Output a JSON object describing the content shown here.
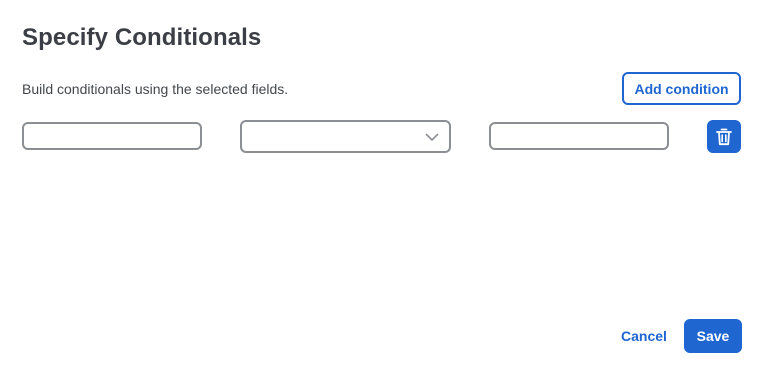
{
  "dialog": {
    "title": "Specify Conditionals",
    "description": "Build conditionals using the selected fields.",
    "add_condition_label": "Add condition",
    "cancel_label": "Cancel",
    "save_label": "Save"
  },
  "condition_row": {
    "field_value": "",
    "operator_value": "",
    "comparison_value": "",
    "delete_icon": "trash-icon",
    "select_icon": "chevron-down-icon"
  },
  "colors": {
    "accent": "#1f66d1",
    "border": "#8b8f94",
    "title": "#3b3f45"
  }
}
